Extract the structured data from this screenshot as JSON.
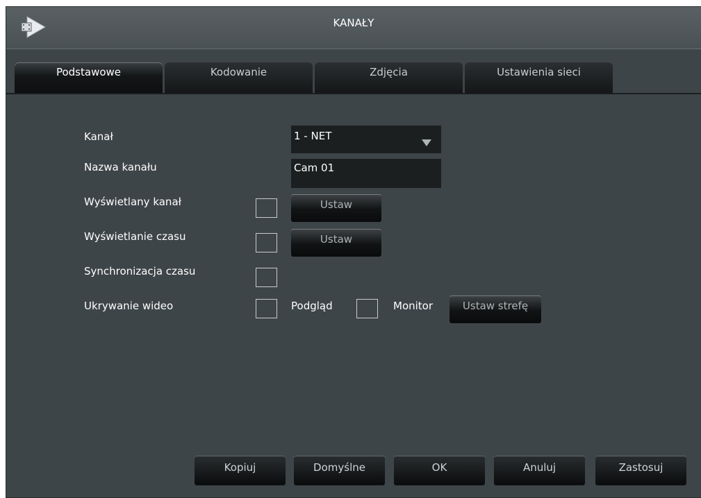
{
  "window": {
    "title": "KANAŁY",
    "app_icon": "play-arrow-icon"
  },
  "tabs": [
    {
      "label": "Podstawowe",
      "active": true
    },
    {
      "label": "Kodowanie",
      "active": false
    },
    {
      "label": "Zdjęcia",
      "active": false
    },
    {
      "label": "Ustawienia sieci",
      "active": false
    }
  ],
  "form": {
    "channel": {
      "label": "Kanał",
      "value": "1 - NET",
      "arrow_icon": "dropdown-arrow-icon"
    },
    "channel_name": {
      "label": "Nazwa kanału",
      "value": "Cam 01"
    },
    "display_channel": {
      "label": "Wyświetlany kanał",
      "checked": false,
      "button": "Ustaw"
    },
    "display_time": {
      "label": "Wyświetlanie czasu",
      "checked": false,
      "button": "Ustaw"
    },
    "time_sync": {
      "label": "Synchronizacja czasu",
      "checked": false
    },
    "video_hide": {
      "label": "Ukrywanie wideo",
      "preview_checked": false,
      "preview_label": "Podgląd",
      "monitor_checked": false,
      "monitor_label": "Monitor",
      "zone_button": "Ustaw strefę"
    }
  },
  "footer": {
    "copy": "Kopiuj",
    "defaults": "Domyślne",
    "ok": "OK",
    "cancel": "Anuluj",
    "apply": "Zastosuj"
  },
  "colors": {
    "background": "#3e4548",
    "titlebar": "#50575a",
    "field": "#1c1f20",
    "text": "#ffffff"
  }
}
